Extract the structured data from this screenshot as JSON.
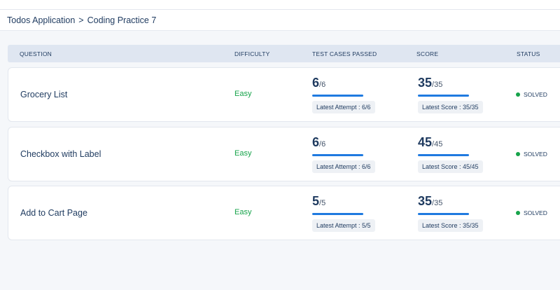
{
  "breadcrumb": {
    "parent": "Todos Application",
    "separator": ">",
    "current": "Coding Practice 7"
  },
  "table": {
    "columns": {
      "question": "QUESTION",
      "difficulty": "DIFFICULTY",
      "tests": "TEST CASES PASSED",
      "score": "SCORE",
      "status": "STATUS"
    },
    "rows": [
      {
        "title": "Grocery List",
        "difficulty": "Easy",
        "tests_passed": "6",
        "tests_total": "/6",
        "tests_fraction": 1.0,
        "latest_attempt": "Latest Attempt : 6/6",
        "score": "35",
        "score_total": "/35",
        "score_fraction": 1.0,
        "latest_score": "Latest Score : 35/35",
        "status": "SOLVED"
      },
      {
        "title": "Checkbox with Label",
        "difficulty": "Easy",
        "tests_passed": "6",
        "tests_total": "/6",
        "tests_fraction": 1.0,
        "latest_attempt": "Latest Attempt : 6/6",
        "score": "45",
        "score_total": "/45",
        "score_fraction": 1.0,
        "latest_score": "Latest Score : 45/45",
        "status": "SOLVED"
      },
      {
        "title": "Add to Cart Page",
        "difficulty": "Easy",
        "tests_passed": "5",
        "tests_total": "/5",
        "tests_fraction": 1.0,
        "latest_attempt": "Latest Attempt : 5/5",
        "score": "35",
        "score_total": "/35",
        "score_fraction": 1.0,
        "latest_score": "Latest Score : 35/35",
        "status": "SOLVED"
      }
    ]
  },
  "colors": {
    "difficulty_easy": "#16a34a",
    "status_solved": "#16a34a",
    "progress_bar": "#1f7ae0"
  }
}
